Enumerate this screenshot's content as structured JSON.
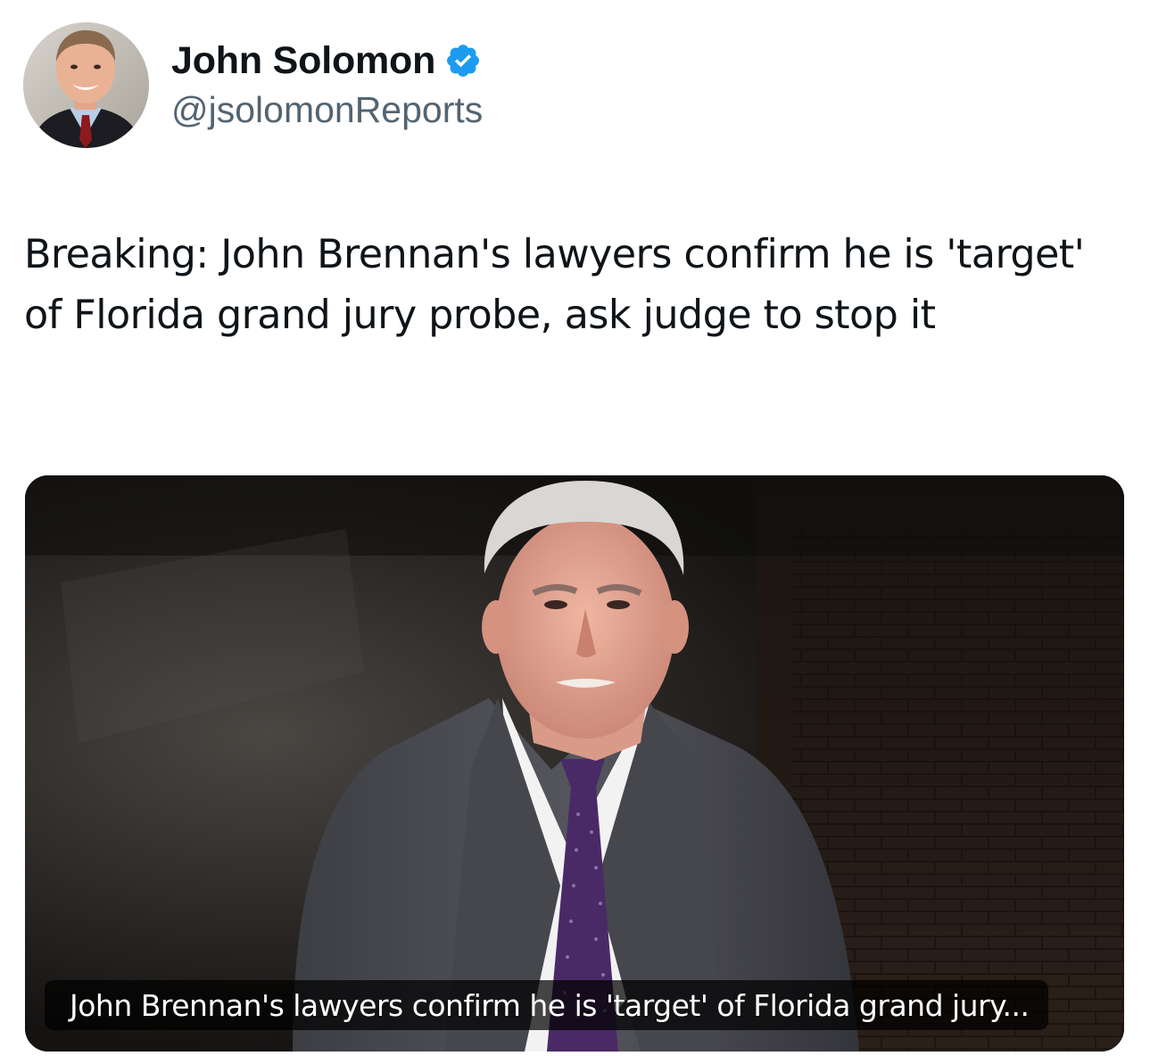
{
  "author": {
    "display_name": "John Solomon",
    "handle": "@jsolomonReports",
    "verified": true,
    "avatar_icon": "profile-photo"
  },
  "tweet": {
    "text": "Breaking: John Brennan's lawyers confirm he is 'target' of Florida grand jury probe, ask judge to stop it"
  },
  "media": {
    "image_icon": "photo-of-man-in-suit",
    "caption": "John Brennan's lawyers confirm he is 'target' of Florida grand jury..."
  },
  "colors": {
    "text_primary": "#0f1419",
    "text_secondary": "#536471",
    "verified_blue": "#1d9bf0",
    "background": "#ffffff"
  }
}
